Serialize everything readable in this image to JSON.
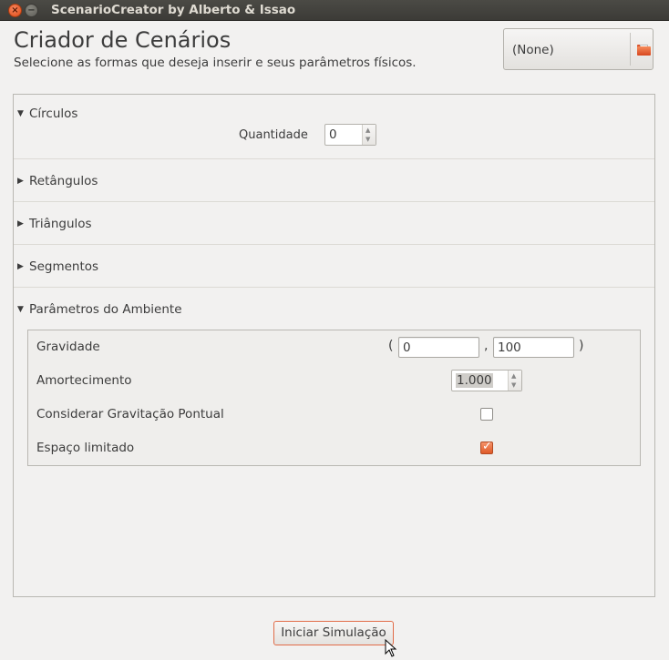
{
  "window": {
    "title": "ScenarioCreator by Alberto & Issao",
    "close_glyph": "×",
    "minimize_glyph": "−"
  },
  "header": {
    "title": "Criador de Cenários",
    "subtitle": "Selecione as formas que deseja inserir e seus parâmetros físicos."
  },
  "file_chooser": {
    "value": "(None)",
    "icon": "folder-icon"
  },
  "sections": {
    "circulos": {
      "label": "Círculos",
      "expanded": true,
      "quantity_label": "Quantidade",
      "quantity_value": "0"
    },
    "retangulos": {
      "label": "Retângulos",
      "expanded": false
    },
    "triangulos": {
      "label": "Triângulos",
      "expanded": false
    },
    "segmentos": {
      "label": "Segmentos",
      "expanded": false
    },
    "ambiente": {
      "label": "Parâmetros do Ambiente",
      "expanded": true
    }
  },
  "arrows": {
    "expanded": "▼",
    "collapsed": "▶"
  },
  "ambiente": {
    "gravidade_label": "Gravidade",
    "gravidade_open": "(",
    "gravidade_x": "0",
    "gravidade_comma": ",",
    "gravidade_y": "100",
    "gravidade_close": ")",
    "amortecimento_label": "Amortecimento",
    "amortecimento_value": "1.000",
    "gravitacao_label": "Considerar Gravitação Pontual",
    "gravitacao_checked": false,
    "espaco_label": "Espaço limitado",
    "espaco_checked": true
  },
  "spin_glyphs": {
    "up": "▲",
    "down": "▼"
  },
  "check_glyph": "✓",
  "start_button": {
    "label": "Iniciar Simulação"
  },
  "colors": {
    "accent": "#e05a28",
    "titlebar": "#3c3b37"
  }
}
